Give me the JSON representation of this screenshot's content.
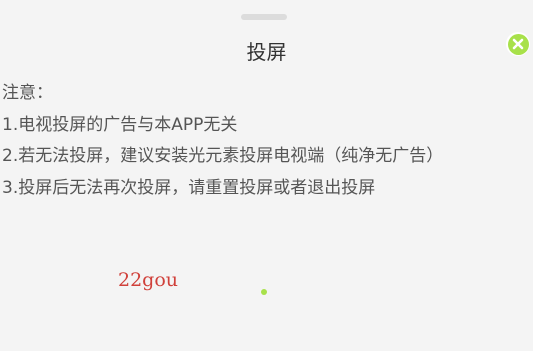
{
  "dialog": {
    "title": "投屏",
    "close_icon": "close-icon",
    "notes": [
      "注意：",
      "1.电视投屏的广告与本APP无关",
      "2.若无法投屏，建议安装光元素投屏电视端（纯净无广告）",
      "3.投屏后无法再次投屏，请重置投屏或者退出投屏"
    ]
  },
  "watermark": {
    "text": "22gou"
  },
  "colors": {
    "accent": "#a8e14a",
    "watermark": "#d0403a"
  }
}
